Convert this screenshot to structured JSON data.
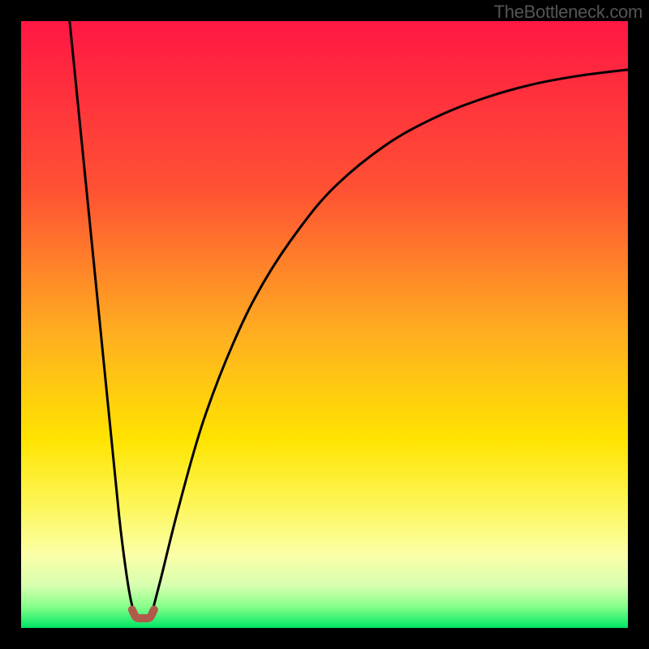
{
  "attribution": "TheBottleneck.com",
  "chart_data": {
    "type": "line",
    "title": "",
    "xlabel": "",
    "ylabel": "",
    "xlim": [
      0,
      100
    ],
    "ylim": [
      0,
      100
    ],
    "gradient_stops": [
      {
        "pct": 0,
        "color": "#ff1744"
      },
      {
        "pct": 28,
        "color": "#ff5233"
      },
      {
        "pct": 52,
        "color": "#ffb020"
      },
      {
        "pct": 69,
        "color": "#ffe400"
      },
      {
        "pct": 80,
        "color": "#fdf65a"
      },
      {
        "pct": 88,
        "color": "#fbffa8"
      },
      {
        "pct": 93,
        "color": "#d8ffb0"
      },
      {
        "pct": 96.5,
        "color": "#86ff8a"
      },
      {
        "pct": 100,
        "color": "#00e765"
      }
    ],
    "series": [
      {
        "name": "left-branch",
        "description": "descending quasi-linear fall from top-left into the valley",
        "x": [
          8.0,
          10.0,
          12.0,
          13.5,
          15.0,
          16.2,
          17.2,
          18.0,
          18.7
        ],
        "y": [
          100,
          80,
          60,
          45,
          30,
          18,
          10,
          5,
          2.2
        ]
      },
      {
        "name": "valley",
        "description": "small U-shaped minimum segment colored brown",
        "color": "#b05a4a",
        "x": [
          18.3,
          18.9,
          19.5,
          20.1,
          20.7,
          21.3,
          21.9
        ],
        "y": [
          3.0,
          1.8,
          1.6,
          1.6,
          1.6,
          1.8,
          3.0
        ]
      },
      {
        "name": "right-branch",
        "description": "rising saturating curve from valley toward upper-right",
        "x": [
          21.5,
          23,
          26,
          30,
          35,
          40,
          46,
          52,
          60,
          68,
          76,
          84,
          92,
          100
        ],
        "y": [
          2.2,
          8,
          20,
          34,
          47,
          57,
          66,
          73,
          79.5,
          84,
          87.2,
          89.5,
          91,
          92
        ]
      }
    ]
  }
}
